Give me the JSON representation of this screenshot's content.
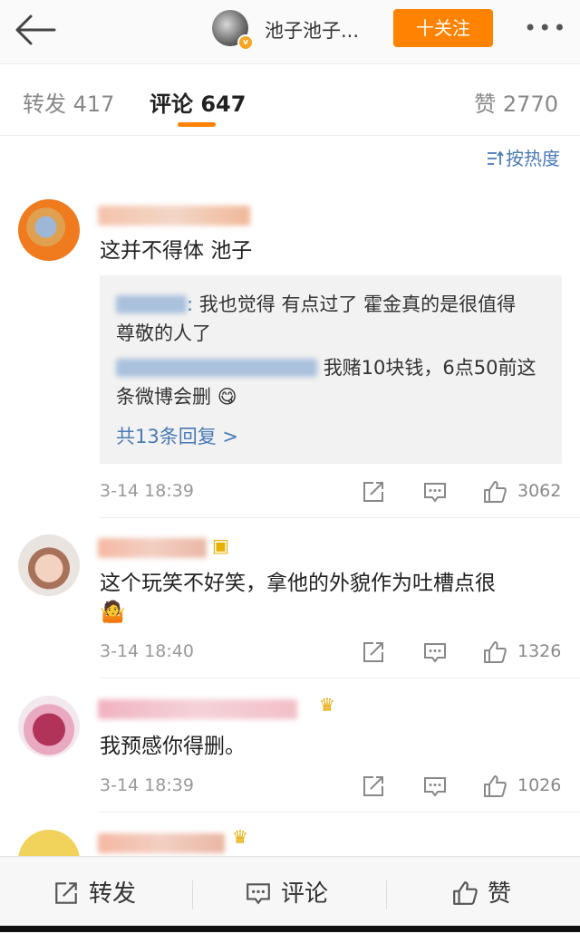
{
  "header": {
    "author_name": "池子池子...",
    "follow_label": "十关注",
    "more_label": "•••"
  },
  "tabs": {
    "repost": "转发 417",
    "comment": "评论 647",
    "like": "赞 2770"
  },
  "sort_label": "按热度",
  "comments": [
    {
      "text": "这并不得体 池子",
      "time": "3-14 18:39",
      "likes": "3062",
      "replies": [
        {
          "text_a": "我也觉得 有点过了 霍金真的是很值得",
          "text_b": "尊敬的人了"
        },
        {
          "text_a": "我赌10块钱，6点50前这",
          "text_b": "条微博会删"
        }
      ],
      "more_replies": "共13条回复 >"
    },
    {
      "text_a": "这个玩笑不好笑，拿他的外貌作为吐槽点很",
      "time": "3-14 18:40",
      "likes": "1326"
    },
    {
      "text": "我预感你得删。",
      "time": "3-14 18:39",
      "likes": "1026"
    }
  ],
  "bottom_bar": {
    "repost": "转发",
    "comment": "评论",
    "like": "赞"
  },
  "colors": {
    "accent_orange": "#ff8200",
    "link_blue": "#4a7ab6"
  }
}
